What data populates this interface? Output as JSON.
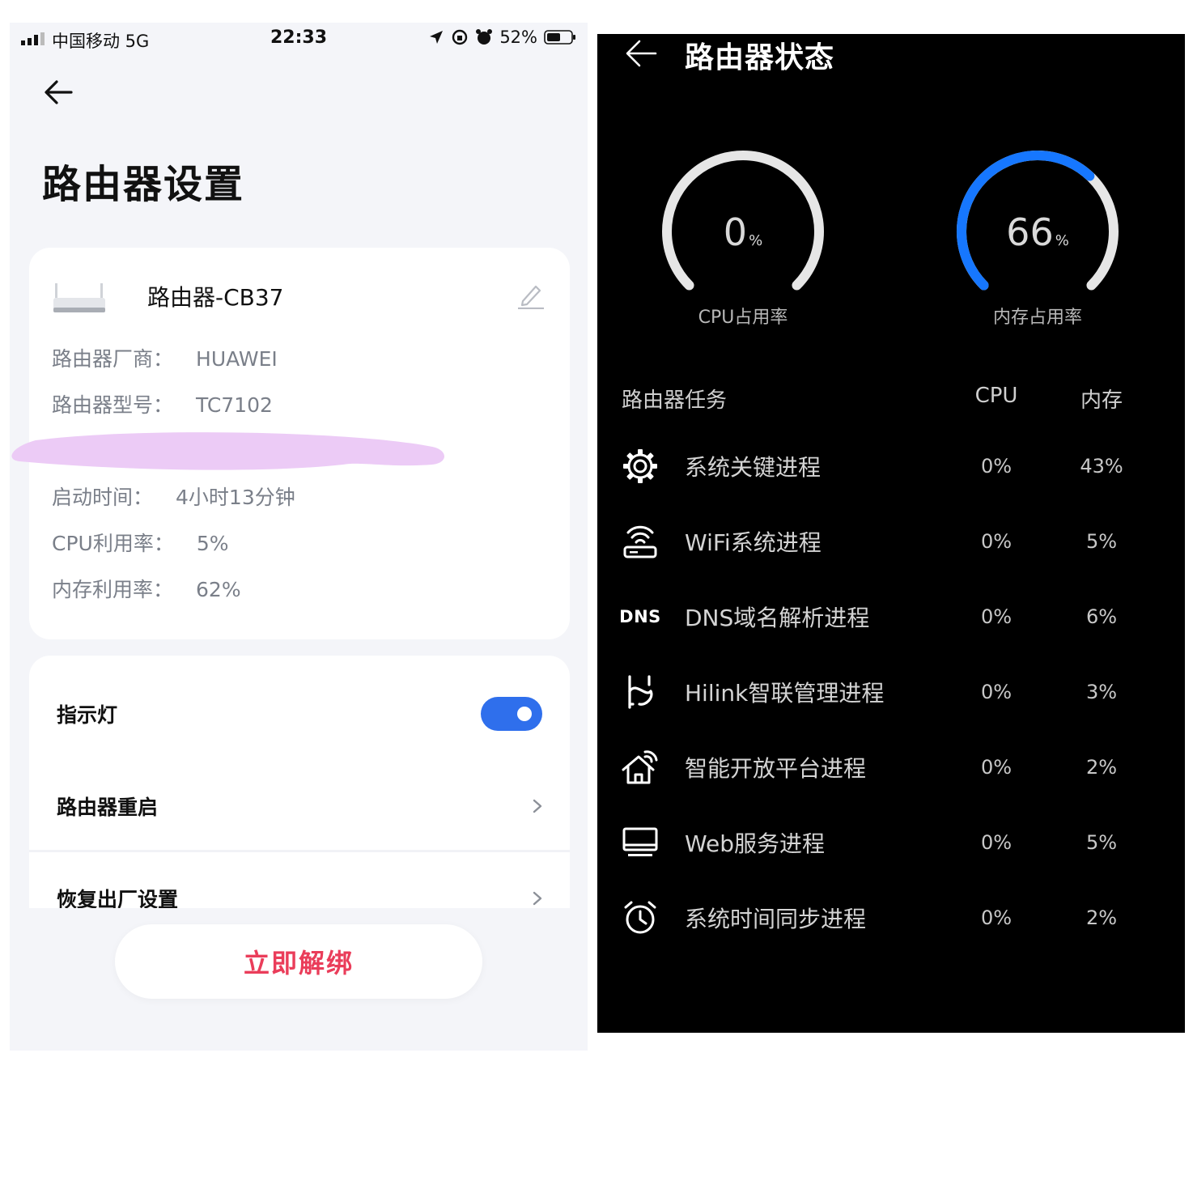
{
  "left": {
    "statusbar": {
      "carrier": "中国移动  5G",
      "time": "22:33",
      "battery": "52%"
    },
    "page_title": "路由器设置",
    "router": {
      "name": "路由器-CB37",
      "vendor_label": "路由器厂商：",
      "vendor_value": "HUAWEI",
      "model_label": "路由器型号：",
      "model_value": "TC7102",
      "uptime_label": "启动时间：",
      "uptime_value": "4小时13分钟",
      "cpu_label": "CPU利用率：",
      "cpu_value": "5%",
      "mem_label": "内存利用率：",
      "mem_value": "62%"
    },
    "settings": {
      "indicator_label": "指示灯",
      "indicator_on": true,
      "restart_label": "路由器重启",
      "reset_label": "恢复出厂设置"
    },
    "unbind_label": "立即解绑",
    "colors": {
      "accent": "#2f6fec",
      "danger": "#ea3d5a",
      "redaction": "#eccbf6"
    }
  },
  "right": {
    "title": "路由器状态",
    "gauges": [
      {
        "value": 0,
        "unit": "%",
        "label": "CPU占用率"
      },
      {
        "value": 66,
        "unit": "%",
        "label": "内存占用率"
      }
    ],
    "colors": {
      "gauge_track": "#e6e6e6",
      "gauge_fill": "#1677ff"
    },
    "tasks_header": {
      "task": "路由器任务",
      "cpu": "CPU",
      "mem": "内存"
    },
    "tasks": [
      {
        "icon": "gear-icon",
        "name": "系统关键进程",
        "cpu": "0%",
        "mem": "43%"
      },
      {
        "icon": "wifi-router-icon",
        "name": "WiFi系统进程",
        "cpu": "0%",
        "mem": "5%"
      },
      {
        "icon": "dns-icon",
        "icon_text": "DNS",
        "name": "DNS域名解析进程",
        "cpu": "0%",
        "mem": "6%"
      },
      {
        "icon": "hilink-icon",
        "name": "Hilink智联管理进程",
        "cpu": "0%",
        "mem": "3%"
      },
      {
        "icon": "smart-home-icon",
        "name": "智能开放平台进程",
        "cpu": "0%",
        "mem": "2%"
      },
      {
        "icon": "monitor-icon",
        "name": "Web服务进程",
        "cpu": "0%",
        "mem": "5%"
      },
      {
        "icon": "alarm-clock-icon",
        "name": "系统时间同步进程",
        "cpu": "0%",
        "mem": "2%"
      }
    ]
  }
}
